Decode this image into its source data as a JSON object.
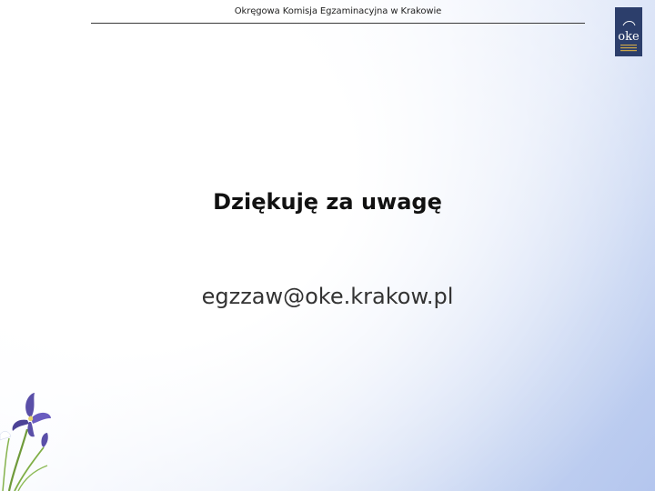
{
  "header": {
    "title": "Okręgowa Komisja Egzaminacyjna w Krakowie"
  },
  "logo": {
    "text": "oke",
    "icon": "oke-logo-icon"
  },
  "content": {
    "thanks": "Dziękuję za uwagę",
    "email": "egzzaw@oke.krakow.pl"
  },
  "decoration": {
    "icon": "iris-flower-icon"
  },
  "colors": {
    "logo_background": "#2c3e6b",
    "flower_petal": "#5a4fa8",
    "flower_stem": "#6f9a3a"
  }
}
